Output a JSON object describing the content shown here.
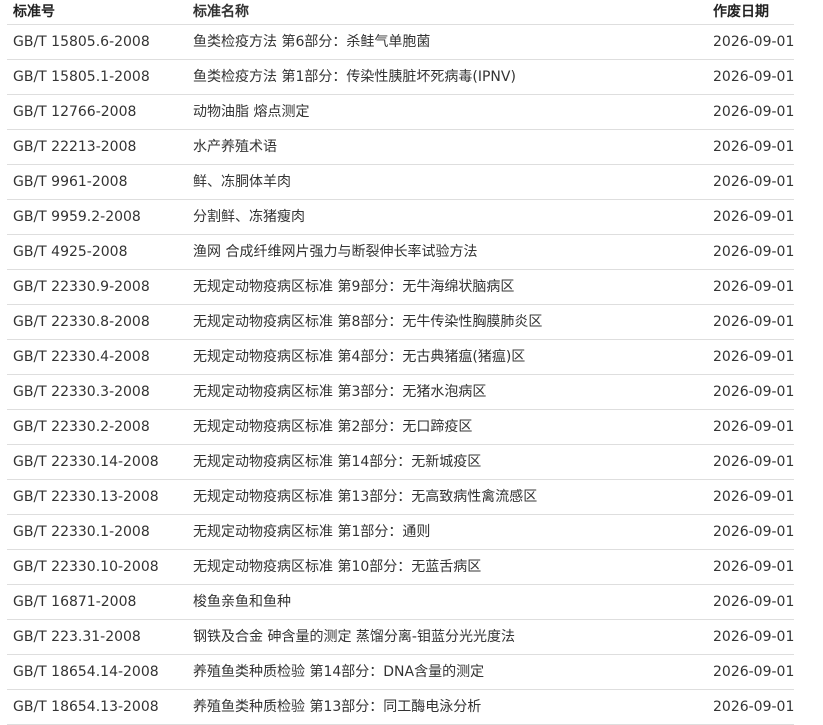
{
  "header": {
    "code": "标准号",
    "name": "标准名称",
    "date": "作废日期"
  },
  "rows": [
    {
      "code": "GB/T 15805.6-2008",
      "name": "鱼类检疫方法 第6部分：杀鲑气单胞菌",
      "date": "2026-09-01"
    },
    {
      "code": "GB/T 15805.1-2008",
      "name": "鱼类检疫方法 第1部分：传染性胰脏坏死病毒(IPNV)",
      "date": "2026-09-01"
    },
    {
      "code": "GB/T 12766-2008",
      "name": "动物油脂 熔点测定",
      "date": "2026-09-01"
    },
    {
      "code": "GB/T 22213-2008",
      "name": "水产养殖术语",
      "date": "2026-09-01"
    },
    {
      "code": "GB/T 9961-2008",
      "name": "鲜、冻胴体羊肉",
      "date": "2026-09-01"
    },
    {
      "code": "GB/T 9959.2-2008",
      "name": "分割鲜、冻猪瘦肉",
      "date": "2026-09-01"
    },
    {
      "code": "GB/T 4925-2008",
      "name": "渔网 合成纤维网片强力与断裂伸长率试验方法",
      "date": "2026-09-01"
    },
    {
      "code": "GB/T 22330.9-2008",
      "name": "无规定动物疫病区标准 第9部分：无牛海绵状脑病区",
      "date": "2026-09-01"
    },
    {
      "code": "GB/T 22330.8-2008",
      "name": "无规定动物疫病区标准 第8部分：无牛传染性胸膜肺炎区",
      "date": "2026-09-01"
    },
    {
      "code": "GB/T 22330.4-2008",
      "name": "无规定动物疫病区标准 第4部分：无古典猪瘟(猪瘟)区",
      "date": "2026-09-01"
    },
    {
      "code": "GB/T 22330.3-2008",
      "name": "无规定动物疫病区标准 第3部分：无猪水泡病区",
      "date": "2026-09-01"
    },
    {
      "code": "GB/T 22330.2-2008",
      "name": "无规定动物疫病区标准 第2部分：无口蹄疫区",
      "date": "2026-09-01"
    },
    {
      "code": "GB/T 22330.14-2008",
      "name": "无规定动物疫病区标准 第14部分：无新城疫区",
      "date": "2026-09-01"
    },
    {
      "code": "GB/T 22330.13-2008",
      "name": "无规定动物疫病区标准 第13部分：无高致病性禽流感区",
      "date": "2026-09-01"
    },
    {
      "code": "GB/T 22330.1-2008",
      "name": "无规定动物疫病区标准 第1部分：通则",
      "date": "2026-09-01"
    },
    {
      "code": "GB/T 22330.10-2008",
      "name": "无规定动物疫病区标准 第10部分：无蓝舌病区",
      "date": "2026-09-01"
    },
    {
      "code": "GB/T 16871-2008",
      "name": "梭鱼亲鱼和鱼种",
      "date": "2026-09-01"
    },
    {
      "code": "GB/T 223.31-2008",
      "name": "钢铁及合金 砷含量的测定 蒸馏分离-钼蓝分光光度法",
      "date": "2026-09-01"
    },
    {
      "code": "GB/T 18654.14-2008",
      "name": "养殖鱼类种质检验 第14部分：DNA含量的测定",
      "date": "2026-09-01"
    },
    {
      "code": "GB/T 18654.13-2008",
      "name": "养殖鱼类种质检验 第13部分：同工酶电泳分析",
      "date": "2026-09-01"
    }
  ]
}
